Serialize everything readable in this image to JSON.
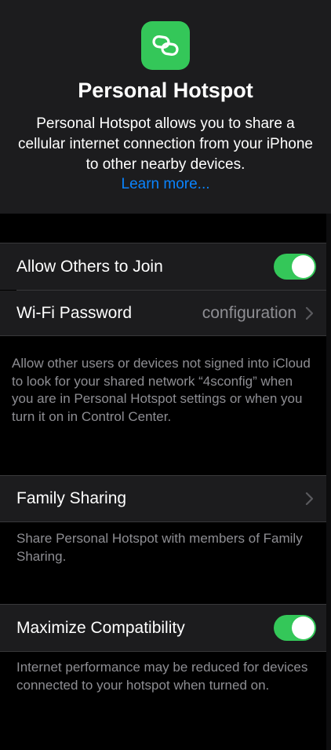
{
  "header": {
    "icon": "link-chain-icon",
    "title": "Personal Hotspot",
    "description": "Personal Hotspot allows you to share a cellular internet connection from your iPhone to other nearby devices.",
    "learn_more": "Learn more..."
  },
  "section_join": {
    "allow_others": {
      "label": "Allow Others to Join",
      "on": true
    },
    "wifi_password": {
      "label": "Wi-Fi Password",
      "value": "configuration"
    },
    "note": "Allow other users or devices not signed into iCloud to look for your shared network “4sconfig” when you are in Personal Hotspot settings or when you turn it on in Control Center."
  },
  "section_family": {
    "family_sharing": {
      "label": "Family Sharing"
    },
    "note": "Share Personal Hotspot with members of Family Sharing."
  },
  "section_compat": {
    "maximize": {
      "label": "Maximize Compatibility",
      "on": true
    },
    "note": "Internet performance may be reduced for devices connected to your hotspot when turned on."
  },
  "colors": {
    "accent_green": "#34c759",
    "link_blue": "#0a84ff",
    "cell_background": "#1c1c1e",
    "secondary_text": "#8e8e93"
  }
}
